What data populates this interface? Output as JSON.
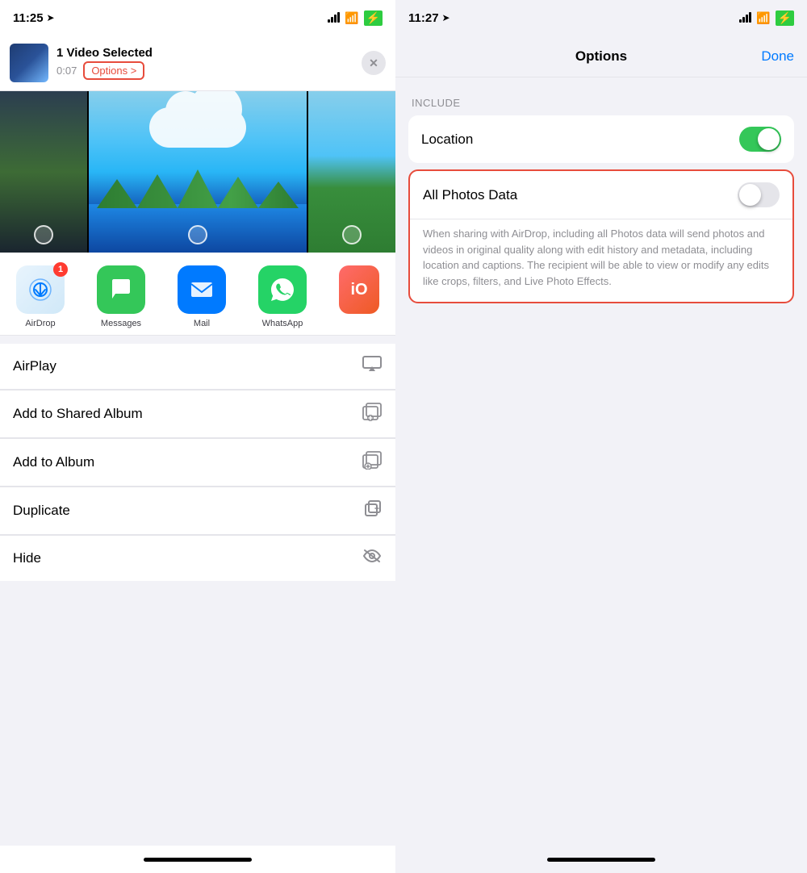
{
  "left": {
    "statusBar": {
      "time": "11:25",
      "navigate_icon": "➤"
    },
    "shareHeader": {
      "title": "1 Video Selected",
      "duration": "0:07",
      "optionsLabel": "Options >",
      "closeLabel": "✕"
    },
    "apps": [
      {
        "id": "airdrop",
        "label": "AirDrop",
        "badge": "1"
      },
      {
        "id": "messages",
        "label": "Messages",
        "badge": ""
      },
      {
        "id": "mail",
        "label": "Mail",
        "badge": ""
      },
      {
        "id": "whatsapp",
        "label": "WhatsApp",
        "badge": ""
      }
    ],
    "menuItems": [
      {
        "label": "AirPlay",
        "icon": "airplay"
      },
      {
        "label": "Add to Shared Album",
        "icon": "shared-album"
      },
      {
        "label": "Add to Album",
        "icon": "add-album"
      },
      {
        "label": "Duplicate",
        "icon": "duplicate"
      },
      {
        "label": "Hide",
        "icon": "hide"
      }
    ]
  },
  "right": {
    "statusBar": {
      "time": "11:27",
      "navigate_icon": "➤"
    },
    "header": {
      "title": "Options",
      "doneLabel": "Done"
    },
    "sectionLabel": "INCLUDE",
    "options": [
      {
        "label": "Location",
        "toggleState": "on",
        "highlighted": false
      },
      {
        "label": "All Photos Data",
        "toggleState": "off",
        "highlighted": true,
        "description": "When sharing with AirDrop, including all Photos data will send photos and videos in original quality along with edit history and metadata, including location and captions. The recipient will be able to view or modify any edits like crops, filters, and Live Photo Effects."
      }
    ]
  }
}
